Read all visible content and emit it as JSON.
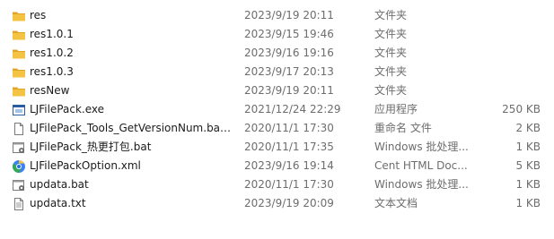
{
  "files": [
    {
      "name": "res",
      "date": "2023/9/19 20:11",
      "type": "文件夹",
      "size": "",
      "icon": "folder-icon"
    },
    {
      "name": "res1.0.1",
      "date": "2023/9/15 19:46",
      "type": "文件夹",
      "size": "",
      "icon": "folder-icon"
    },
    {
      "name": "res1.0.2",
      "date": "2023/9/16 19:16",
      "type": "文件夹",
      "size": "",
      "icon": "folder-icon"
    },
    {
      "name": "res1.0.3",
      "date": "2023/9/17 20:13",
      "type": "文件夹",
      "size": "",
      "icon": "folder-icon"
    },
    {
      "name": "resNew",
      "date": "2023/9/19 20:11",
      "type": "文件夹",
      "size": "",
      "icon": "folder-icon"
    },
    {
      "name": "LJFilePack.exe",
      "date": "2021/12/24 22:29",
      "type": "应用程序",
      "size": "250 KB",
      "icon": "exe-icon"
    },
    {
      "name": "LJFilePack_Tools_GetVersionNum.bat...",
      "date": "2020/11/1 17:30",
      "type": "重命名 文件",
      "size": "2 KB",
      "icon": "document-icon"
    },
    {
      "name": "LJFilePack_热更打包.bat",
      "date": "2020/11/1 17:35",
      "type": "Windows 批处理...",
      "size": "1 KB",
      "icon": "batch-file-icon"
    },
    {
      "name": "LJFilePackOption.xml",
      "date": "2023/9/16 19:14",
      "type": "Cent HTML Doc...",
      "size": "5 KB",
      "icon": "browser-icon"
    },
    {
      "name": "updata.bat",
      "date": "2020/11/1 17:30",
      "type": "Windows 批处理...",
      "size": "1 KB",
      "icon": "batch-file-icon"
    },
    {
      "name": "updata.txt",
      "date": "2023/9/19 20:09",
      "type": "文本文档",
      "size": "1 KB",
      "icon": "text-file-icon"
    }
  ],
  "colors": {
    "folder": "#f5c343",
    "folder_dark": "#e0a526",
    "text": "#1b1b1b",
    "secondary_text": "#6d6d6d",
    "hover": "#e5f3ff"
  }
}
